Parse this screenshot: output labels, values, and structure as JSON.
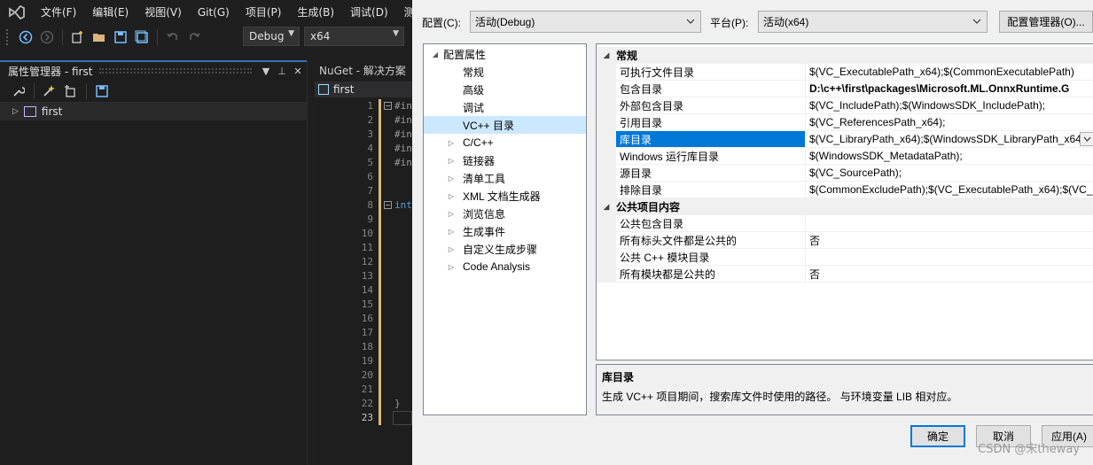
{
  "vs": {
    "menu": [
      "文件(F)",
      "编辑(E)",
      "视图(V)",
      "Git(G)",
      "项目(P)",
      "生成(B)",
      "调试(D)",
      "测"
    ],
    "toolbar": {
      "config": "Debug",
      "platform": "x64"
    },
    "property_manager": {
      "title": "属性管理器 - first",
      "project": "first"
    },
    "editor": {
      "nuget_tab": "NuGet - 解决方案",
      "file_tab": "first",
      "line_numbers": [
        "1",
        "2",
        "3",
        "4",
        "5",
        "6",
        "7",
        "8",
        "9",
        "10",
        "11",
        "12",
        "13",
        "14",
        "15",
        "16",
        "17",
        "18",
        "19",
        "20",
        "21",
        "22",
        "23"
      ],
      "code": {
        "inc1": "#in",
        "inc2": "#in",
        "inc3": "#in",
        "inc4": "#in",
        "inc5": "#in",
        "int": "int",
        "brace": "}"
      }
    }
  },
  "dialog": {
    "config_label": "配置(C):",
    "config_value": "活动(Debug)",
    "platform_label": "平台(P):",
    "platform_value": "活动(x64)",
    "config_manager_button": "配置管理器(O)...",
    "tree": {
      "root": "配置属性",
      "items": [
        {
          "label": "常规",
          "expandable": false
        },
        {
          "label": "高级",
          "expandable": false
        },
        {
          "label": "调试",
          "expandable": false
        },
        {
          "label": "VC++ 目录",
          "expandable": false,
          "selected": true
        },
        {
          "label": "C/C++",
          "expandable": true
        },
        {
          "label": "链接器",
          "expandable": true
        },
        {
          "label": "清单工具",
          "expandable": true
        },
        {
          "label": "XML 文档生成器",
          "expandable": true
        },
        {
          "label": "浏览信息",
          "expandable": true
        },
        {
          "label": "生成事件",
          "expandable": true
        },
        {
          "label": "自定义生成步骤",
          "expandable": true
        },
        {
          "label": "Code Analysis",
          "expandable": true
        }
      ]
    },
    "grid": {
      "general_category": "常规",
      "general_rows": [
        {
          "name": "可执行文件目录",
          "value": "$(VC_ExecutablePath_x64);$(CommonExecutablePath)"
        },
        {
          "name": "包含目录",
          "value": "D:\\c++\\first\\packages\\Microsoft.ML.OnnxRuntime.G",
          "bold": true
        },
        {
          "name": "外部包含目录",
          "value": "$(VC_IncludePath);$(WindowsSDK_IncludePath);"
        },
        {
          "name": "引用目录",
          "value": "$(VC_ReferencesPath_x64);"
        },
        {
          "name": "库目录",
          "value": "$(VC_LibraryPath_x64);$(WindowsSDK_LibraryPath_x64",
          "selected": true
        },
        {
          "name": "Windows 运行库目录",
          "value": "$(WindowsSDK_MetadataPath);"
        },
        {
          "name": "源目录",
          "value": "$(VC_SourcePath);"
        },
        {
          "name": "排除目录",
          "value": "$(CommonExcludePath);$(VC_ExecutablePath_x64);$(VC_"
        }
      ],
      "public_category": "公共项目内容",
      "public_rows": [
        {
          "name": "公共包含目录",
          "value": ""
        },
        {
          "name": "所有标头文件都是公共的",
          "value": "否"
        },
        {
          "name": "公共 C++ 模块目录",
          "value": ""
        },
        {
          "name": "所有模块都是公共的",
          "value": "否"
        }
      ]
    },
    "description": {
      "title": "库目录",
      "text": "生成 VC++ 项目期间，搜索库文件时使用的路径。 与环境变量 LIB 相对应。"
    },
    "buttons": {
      "ok": "确定",
      "cancel": "取消",
      "apply": "应用(A)"
    }
  },
  "watermark": "CSDN @宋theway"
}
